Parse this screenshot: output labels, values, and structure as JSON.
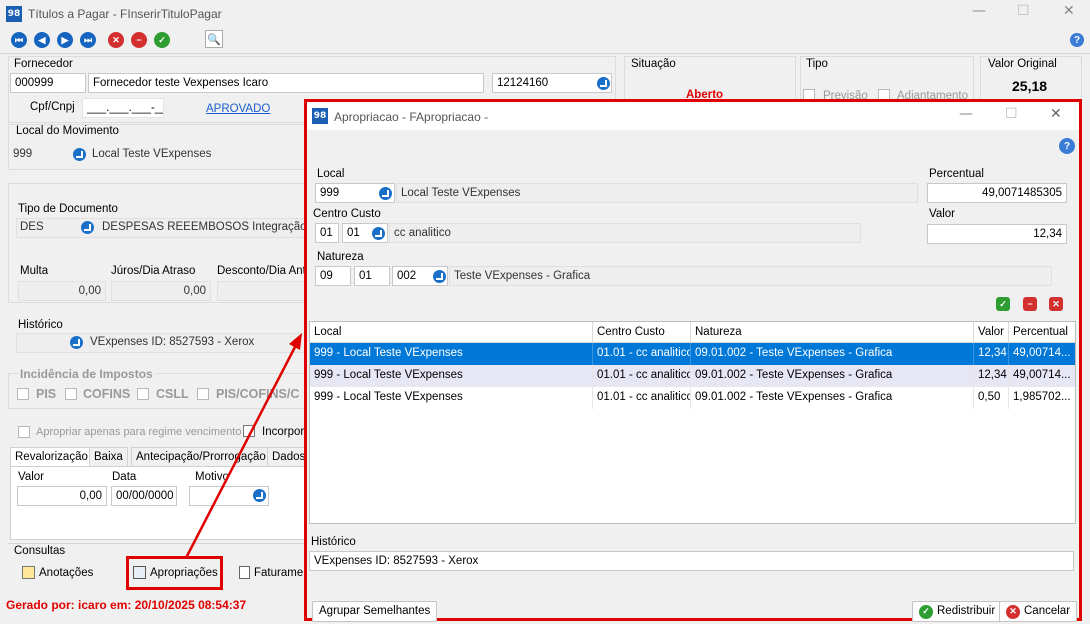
{
  "window": {
    "title": "Títulos a Pagar - FInserirTituloPagar",
    "app_icon": "98"
  },
  "fornecedor": {
    "label": "Fornecedor",
    "code": "000999",
    "name": "Fornecedor teste Vexpenses Icaro",
    "doc": "12124160",
    "cpf_label": "Cpf/Cnpj",
    "cpf_value": "___.___.___-__",
    "status_link": "APROVADO"
  },
  "situacao": {
    "label": "Situação",
    "value": "Aberto"
  },
  "tipo": {
    "label": "Tipo",
    "opt1": "Previsão",
    "opt2": "Adiantamento"
  },
  "valor_original": {
    "label": "Valor Original",
    "value": "25,18"
  },
  "local_mov": {
    "label": "Local do Movimento",
    "code": "999",
    "name": "Local Teste VExpenses"
  },
  "tipo_doc": {
    "label": "Tipo de Documento",
    "code": "DES",
    "name": "DESPESAS REEEMBOSOS Integração"
  },
  "valores": {
    "multa_label": "Multa",
    "multa": "0,00",
    "juros_label": "Júros/Dia Atraso",
    "juros": "0,00",
    "desconto_label": "Desconto/Dia Ant"
  },
  "historico": {
    "label": "Histórico",
    "value": "VExpenses ID: 8527593 - Xerox"
  },
  "impostos": {
    "label": "Incidência de Impostos",
    "pis": "PIS",
    "cofins": "COFINS",
    "csll": "CSLL",
    "piscofins": "PIS/COFINS/C"
  },
  "regime": {
    "apropriar": "Apropriar apenas para regime vencimento",
    "incorpora": "Incorpora"
  },
  "tabs": [
    "Revalorização",
    "Baixa",
    "Antecipação/Prorrogação",
    "Dados"
  ],
  "reval": {
    "valor_label": "Valor",
    "valor": "0,00",
    "data_label": "Data",
    "data": "00/00/0000",
    "motivo_label": "Motivo"
  },
  "consultas": {
    "label": "Consultas",
    "anotacoes": "Anotações",
    "apropriacoes": "Apropriações",
    "faturamento": "Faturamen"
  },
  "footer": {
    "gerado": "Gerado por: icaro em: 20/10/2025 08:54:37"
  },
  "dialog": {
    "title": "Apropriacao - FApropriacao -",
    "app_icon": "98",
    "local_label": "Local",
    "local_code": "999",
    "local_name": "Local Teste VExpenses",
    "percentual_label": "Percentual",
    "percentual": "49,0071485305",
    "centro_label": "Centro Custo",
    "centro_1": "01",
    "centro_2": "01",
    "centro_name": "cc analitico",
    "valor_label": "Valor",
    "valor": "12,34",
    "natureza_label": "Natureza",
    "nat_1": "09",
    "nat_2": "01",
    "nat_3": "002",
    "nat_name": "Teste VExpenses - Grafica",
    "grid": {
      "headers": [
        "Local",
        "Centro Custo",
        "Natureza",
        "Valor",
        "Percentual"
      ],
      "rows": [
        [
          "999 - Local Teste VExpenses",
          "01.01 - cc analitico",
          "09.01.002 - Teste VExpenses - Grafica",
          "12,34",
          "49,00714..."
        ],
        [
          "999 - Local Teste VExpenses",
          "01.01 - cc analitico",
          "09.01.002 - Teste VExpenses - Grafica",
          "12,34",
          "49,00714..."
        ],
        [
          "999 - Local Teste VExpenses",
          "01.01 - cc analitico",
          "09.01.002 - Teste VExpenses - Grafica",
          "0,50",
          "1,985702..."
        ]
      ]
    },
    "historico_label": "Histórico",
    "historico": "VExpenses ID: 8527593 - Xerox",
    "agrupar": "Agrupar Semelhantes",
    "redistribuir": "Redistribuir",
    "cancelar": "Cancelar"
  },
  "colors": {
    "accent": "#0078d7",
    "highlight_red": "#e00000",
    "row_alt": "#e6e6f5"
  }
}
